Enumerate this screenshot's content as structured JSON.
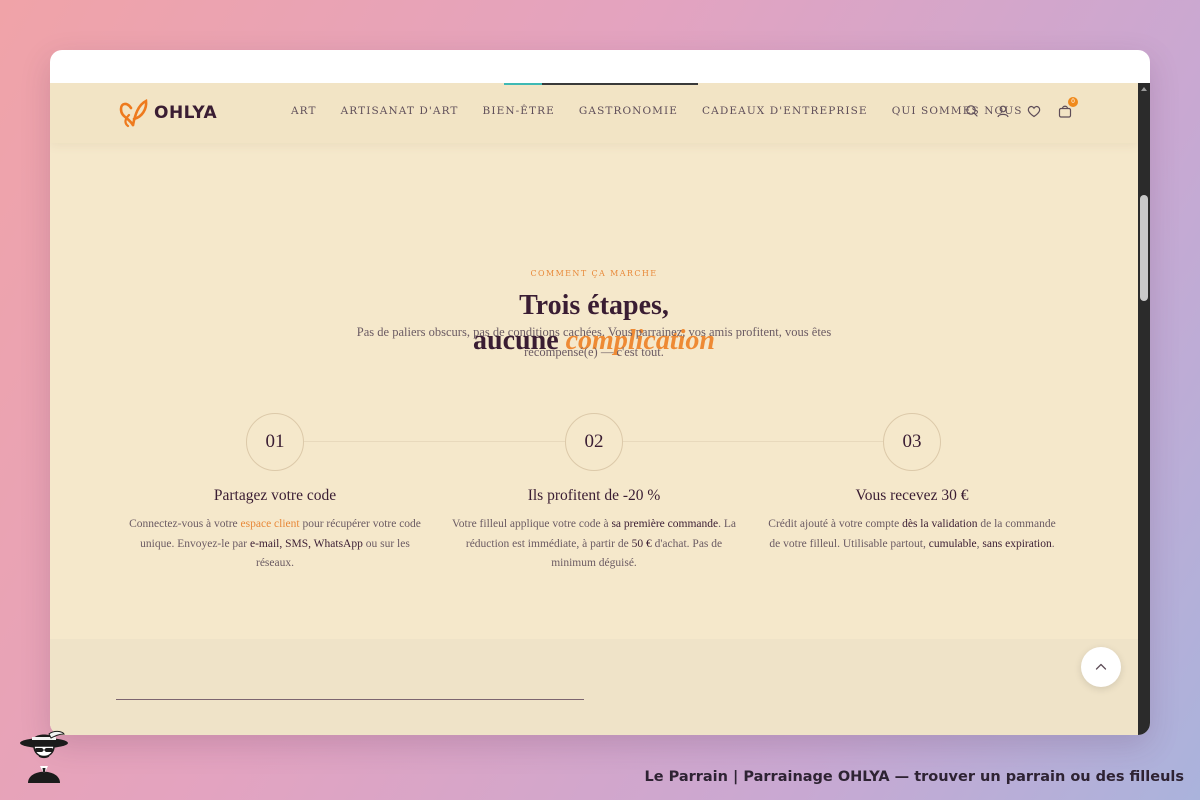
{
  "header": {
    "logo_text": "OHLYA",
    "nav": [
      "ART",
      "ARTISANAT D'ART",
      "BIEN-ÊTRE",
      "GASTRONOMIE",
      "CADEAUX D'ENTREPRISE",
      "QUI SOMMES NOUS"
    ],
    "cart_count": "0",
    "icons": [
      "search-icon",
      "account-icon",
      "heart-icon",
      "cart-icon"
    ]
  },
  "section": {
    "eyebrow": "COMMENT ÇA MARCHE",
    "headline_line1": "Trois étapes,",
    "headline_line2_plain": "aucune",
    "headline_line2_accent": "complication",
    "lead": "Pas de paliers obscurs, pas de conditions cachées. Vous parrainez, vos amis profitent, vous êtes récompensé(e) — c'est tout."
  },
  "steps": [
    {
      "number": "01",
      "title": "Partagez votre code",
      "t1": "Connectez-vous à votre ",
      "t2": "espace client",
      "t3": " pour récupérer votre code unique. Envoyez-le par ",
      "t4": "e-mail, SMS, WhatsApp",
      "t5": " ou sur les réseaux."
    },
    {
      "number": "02",
      "title": "Ils profitent de -20 %",
      "t1": "Votre filleul applique votre code à ",
      "t2": "sa première commande",
      "t3": ". La réduction est immédiate, à partir de ",
      "t4": "50 €",
      "t5": " d'achat. Pas de minimum déguisé."
    },
    {
      "number": "03",
      "title": "Vous recevez 30 €",
      "t1": "Crédit ajouté à votre compte ",
      "t2": "dès la validation",
      "t3": " de la commande de votre filleul. Utilisable partout, ",
      "t4": "cumulable",
      "t5": ", ",
      "t6": "sans expiration",
      "t7": "."
    }
  ],
  "caption": "Le Parrain | Parrainage OHLYA — trouver un parrain ou des filleuls",
  "colors": {
    "accent": "#ee8a34",
    "ink": "#3a1d33",
    "cream": "#f5e8cb"
  }
}
